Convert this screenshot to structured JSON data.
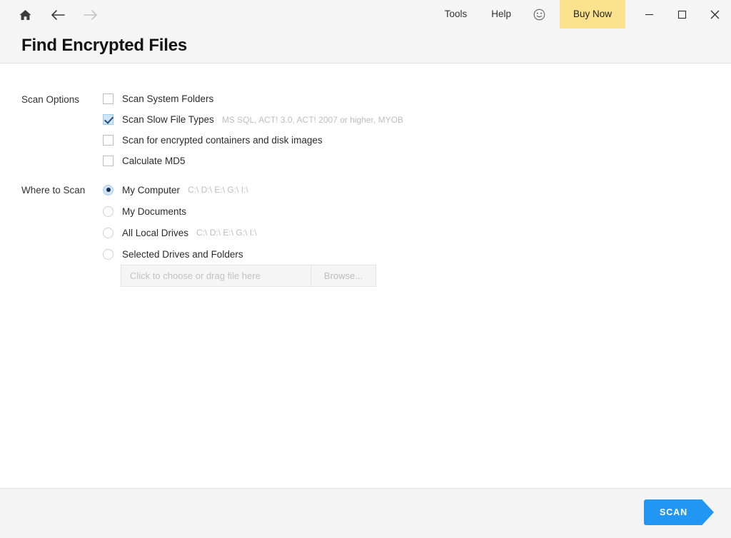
{
  "window": {
    "title": "Find Encrypted Files",
    "nav": {
      "home_label": "Home",
      "back_label": "Back",
      "forward_label": "Forward"
    },
    "menu": [
      {
        "label": "Tools"
      },
      {
        "label": "Help"
      }
    ],
    "feedback_icon": "smiley-icon",
    "buy_now_label": "Buy Now",
    "controls": {
      "minimize": "Minimize",
      "maximize": "Maximize",
      "close": "Close"
    }
  },
  "colors": {
    "accent": "#2196f3",
    "buy_now_bg": "#fae38c",
    "header_bg": "#f5f5f5",
    "footer_bg": "#f4f4f4",
    "checked_fill": "#cfe5f7"
  },
  "scan_options": {
    "label": "Scan Options",
    "items": [
      {
        "label": "Scan System Folders",
        "hint": "",
        "checked": false
      },
      {
        "label": "Scan Slow File Types",
        "hint": "MS SQL, ACT! 3.0, ACT! 2007 or higher, MYOB",
        "checked": true
      },
      {
        "label": "Scan for encrypted containers and disk images",
        "hint": "",
        "checked": false
      },
      {
        "label": "Calculate MD5",
        "hint": "",
        "checked": false
      }
    ]
  },
  "where_to_scan": {
    "label": "Where to Scan",
    "items": [
      {
        "label": "My Computer",
        "hint": "C:\\ D:\\ E:\\ G:\\ I:\\",
        "selected": true
      },
      {
        "label": "My Documents",
        "hint": "",
        "selected": false
      },
      {
        "label": "All Local Drives",
        "hint": "C:\\ D:\\ E:\\ G:\\ I:\\",
        "selected": false
      },
      {
        "label": "Selected Drives and Folders",
        "hint": "",
        "selected": false
      }
    ],
    "file_picker": {
      "placeholder": "Click to choose or drag file here",
      "value": "",
      "browse_label": "Browse..."
    }
  },
  "footer": {
    "scan_label": "SCAN"
  }
}
